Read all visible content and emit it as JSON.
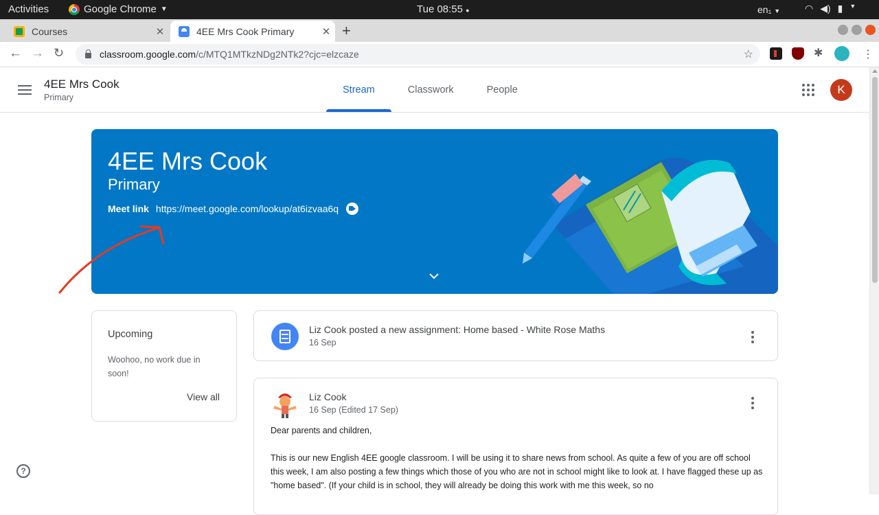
{
  "system_bar": {
    "activities": "Activities",
    "app_name": "Google Chrome",
    "clock": "Tue 08:55",
    "language": "en₁"
  },
  "browser": {
    "tabs": [
      {
        "label": "Courses",
        "close": "✕"
      },
      {
        "label": "4EE Mrs Cook Primary",
        "close": "✕"
      }
    ],
    "new_tab": "+",
    "url_host": "classroom.google.com",
    "url_path": "/c/MTQ1MTkzNDg2NTk2?cjc=elzcaze"
  },
  "header": {
    "class_name": "4EE Mrs Cook",
    "section": "Primary",
    "tabs": [
      "Stream",
      "Classwork",
      "People"
    ],
    "active_tab": "Stream",
    "avatar_letter": "K"
  },
  "banner": {
    "title": "4EE Mrs Cook",
    "subtitle": "Primary",
    "meet_label": "Meet link",
    "meet_url": "https://meet.google.com/lookup/at6izvaa6q",
    "color": "#0277c6"
  },
  "upcoming": {
    "title": "Upcoming",
    "body": "Woohoo, no work due in soon!",
    "view_all": "View all"
  },
  "stream": {
    "assignment": {
      "text": "Liz Cook posted a new assignment: Home based - White Rose Maths",
      "date": "16 Sep"
    },
    "post": {
      "author": "Liz Cook",
      "date": "16 Sep (Edited 17 Sep)",
      "greeting": "Dear parents and children,",
      "body": "This is our new English 4EE google classroom.  I will be using it to share news from school.  As quite a few of you are off school this week, I am also posting a few things which those of you who are not in school might like to look at.  I have flagged these up as \"home based\".  (If your child is in school, they will already be doing this work with me this week, so no"
    }
  },
  "help": "?"
}
